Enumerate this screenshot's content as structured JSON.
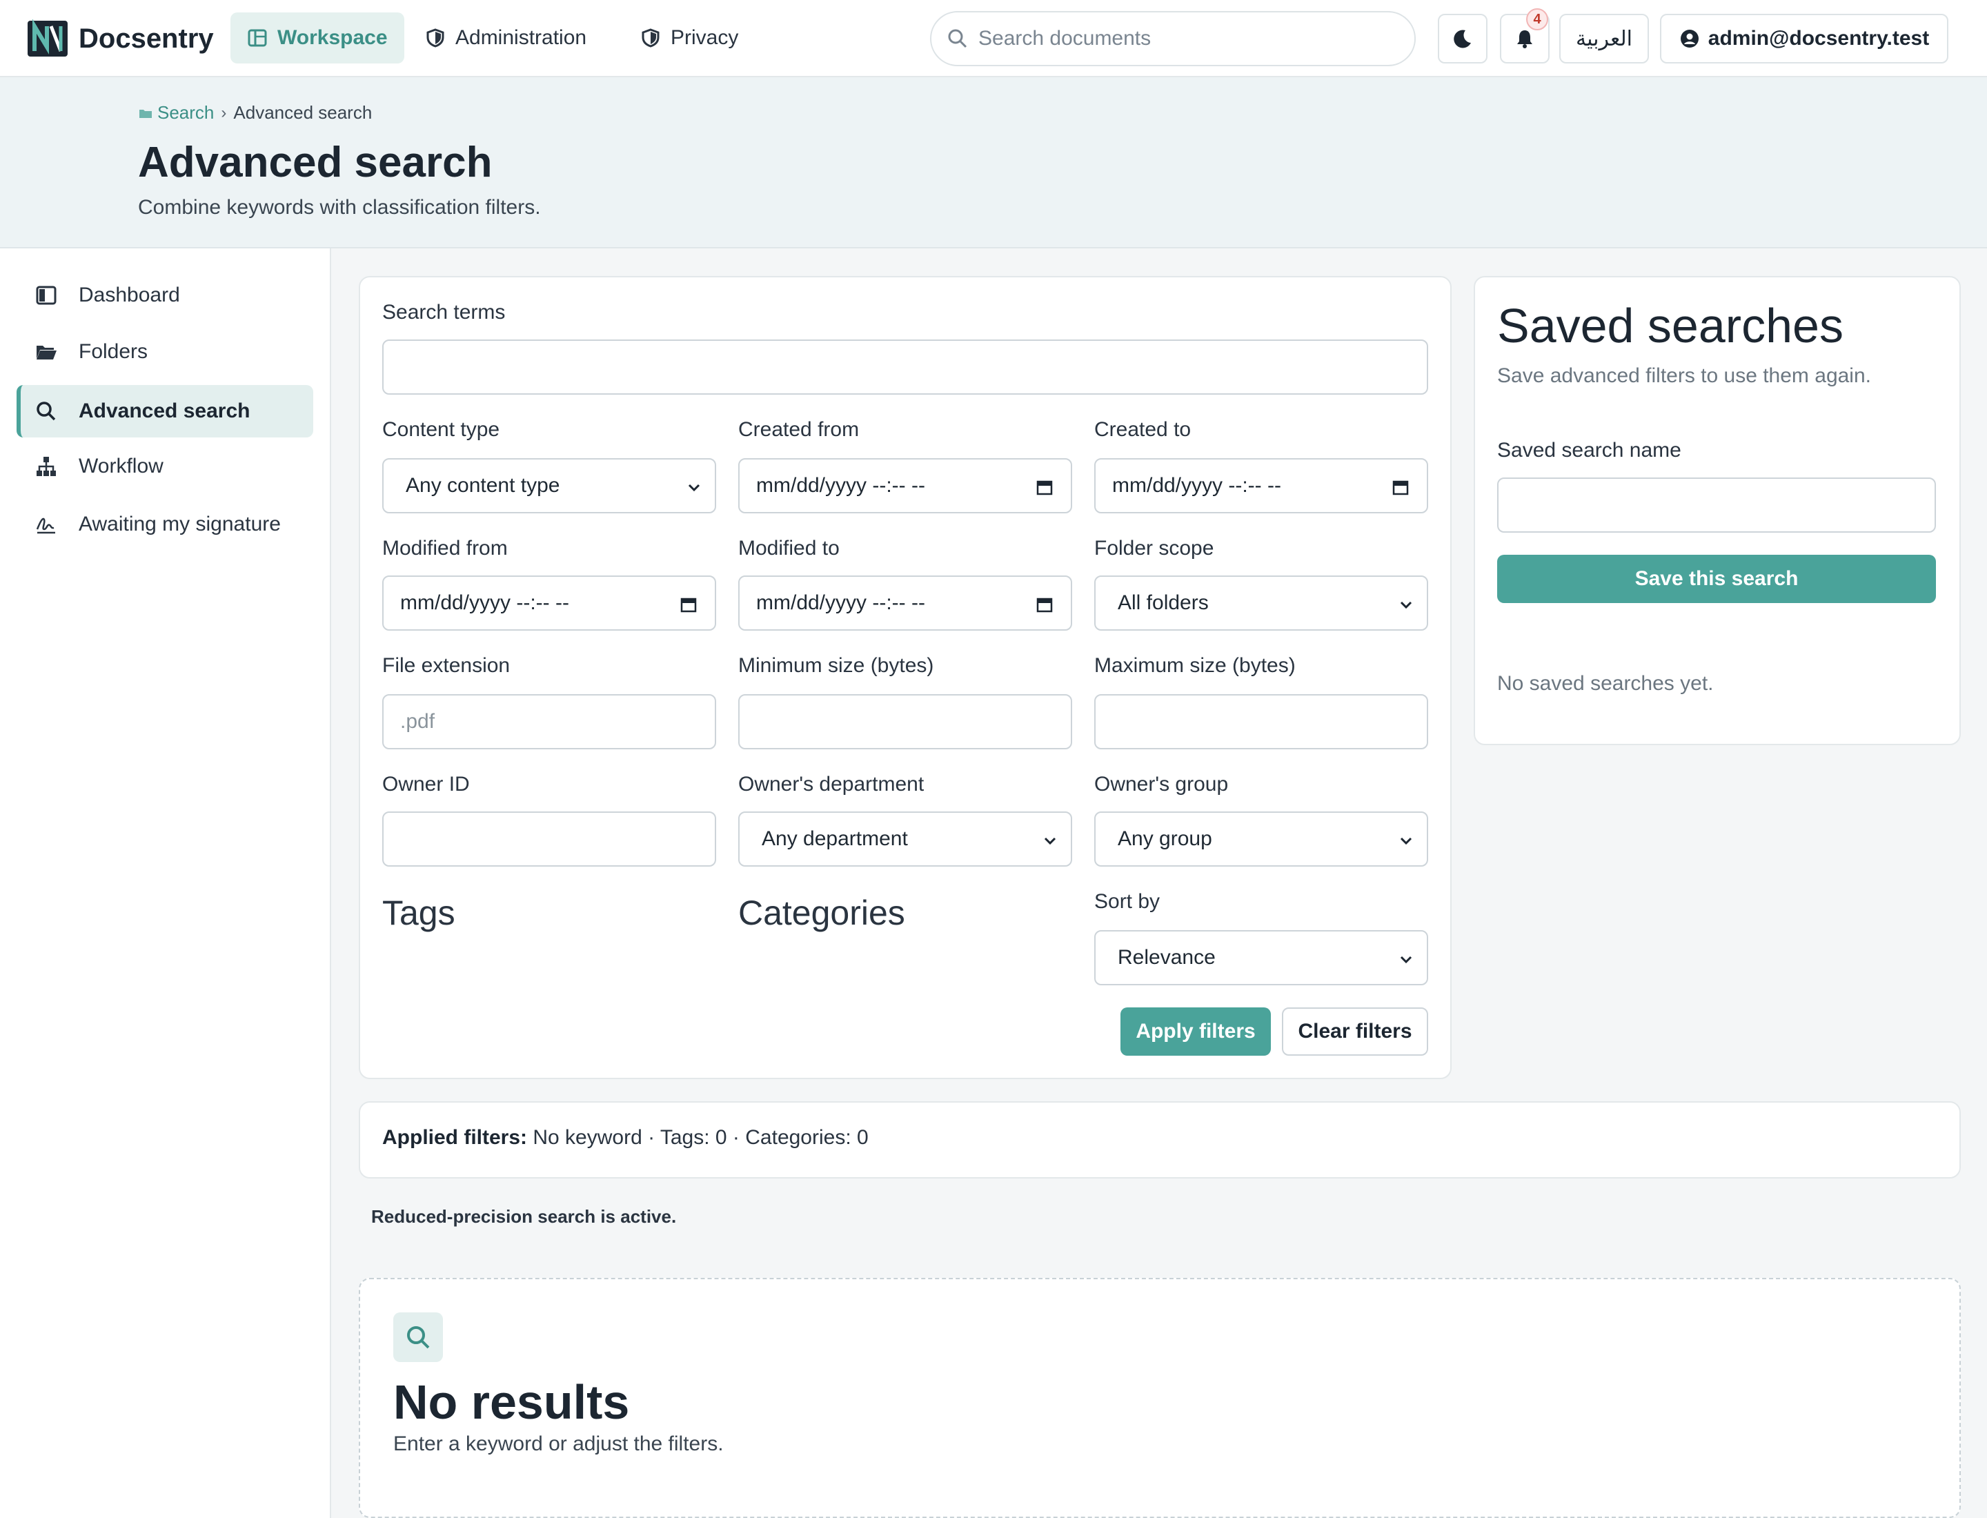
{
  "app": {
    "name": "Docsentry"
  },
  "topnav": {
    "items": [
      {
        "label": "Workspace",
        "icon": "layout-icon",
        "active": true
      },
      {
        "label": "Administration",
        "icon": "shield-icon",
        "active": false
      },
      {
        "label": "Privacy",
        "icon": "shield-icon",
        "active": false
      }
    ],
    "search_placeholder": "Search documents",
    "notification_count": "4",
    "language_label": "العربية",
    "user_email": "admin@docsentry.test"
  },
  "breadcrumb": {
    "root": "Search",
    "current": "Advanced search"
  },
  "page": {
    "title": "Advanced search",
    "subtitle": "Combine keywords with classification filters."
  },
  "sidebar": {
    "items": [
      {
        "label": "Dashboard",
        "icon": "dashboard-icon",
        "active": false
      },
      {
        "label": "Folders",
        "icon": "folder-icon",
        "active": false
      },
      {
        "label": "Advanced search",
        "icon": "search-icon",
        "active": true
      },
      {
        "label": "Workflow",
        "icon": "workflow-icon",
        "active": false
      },
      {
        "label": "Awaiting my signature",
        "icon": "signature-icon",
        "active": false
      }
    ]
  },
  "form": {
    "search_terms": {
      "label": "Search terms",
      "value": ""
    },
    "content_type": {
      "label": "Content type",
      "value": "Any content type"
    },
    "created_from": {
      "label": "Created from",
      "placeholder": "mm/dd/yyyy --:-- --"
    },
    "created_to": {
      "label": "Created to",
      "placeholder": "mm/dd/yyyy --:-- --"
    },
    "modified_from": {
      "label": "Modified from",
      "placeholder": "mm/dd/yyyy --:-- --"
    },
    "modified_to": {
      "label": "Modified to",
      "placeholder": "mm/dd/yyyy --:-- --"
    },
    "folder_scope": {
      "label": "Folder scope",
      "value": "All folders"
    },
    "file_extension": {
      "label": "File extension",
      "placeholder": ".pdf"
    },
    "min_size": {
      "label": "Minimum size (bytes)",
      "value": ""
    },
    "max_size": {
      "label": "Maximum size (bytes)",
      "value": ""
    },
    "owner_id": {
      "label": "Owner ID",
      "value": ""
    },
    "owner_department": {
      "label": "Owner's department",
      "value": "Any department"
    },
    "owner_group": {
      "label": "Owner's group",
      "value": "Any group"
    },
    "tags_heading": "Tags",
    "categories_heading": "Categories",
    "sort_by": {
      "label": "Sort by",
      "value": "Relevance"
    },
    "apply_label": "Apply filters",
    "clear_label": "Clear filters"
  },
  "saved": {
    "title": "Saved searches",
    "subtitle": "Save advanced filters to use them again.",
    "name_label": "Saved search name",
    "name_value": "",
    "save_label": "Save this search",
    "empty_text": "No saved searches yet."
  },
  "applied": {
    "label": "Applied filters:",
    "text": "No keyword · Tags: 0 · Categories: 0"
  },
  "notice": "Reduced-precision search is active.",
  "empty": {
    "title": "No results",
    "subtitle": "Enter a keyword or adjust the filters."
  },
  "colors": {
    "accent": "#4aa39a",
    "accent_light": "#e3efee",
    "header_band": "#edf3f5",
    "text_dark": "#1c2631"
  }
}
